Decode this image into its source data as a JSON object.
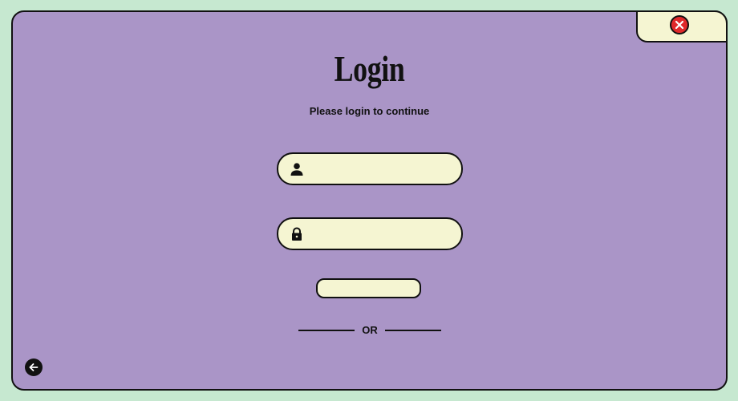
{
  "login": {
    "title": "Login",
    "subtitle": "Please login to continue",
    "username": {
      "value": "",
      "placeholder": "",
      "icon": "user-icon"
    },
    "password": {
      "value": "",
      "placeholder": "",
      "icon": "lock-icon"
    },
    "submit_label": "",
    "divider_label": "OR"
  },
  "window": {
    "close_icon": "close-icon",
    "back_icon": "arrow-left-icon"
  },
  "colors": {
    "background": "#c6e8d0",
    "panel": "#aa95c7",
    "field": "#f5f5d2",
    "close": "#e0282a",
    "ink": "#111111"
  }
}
